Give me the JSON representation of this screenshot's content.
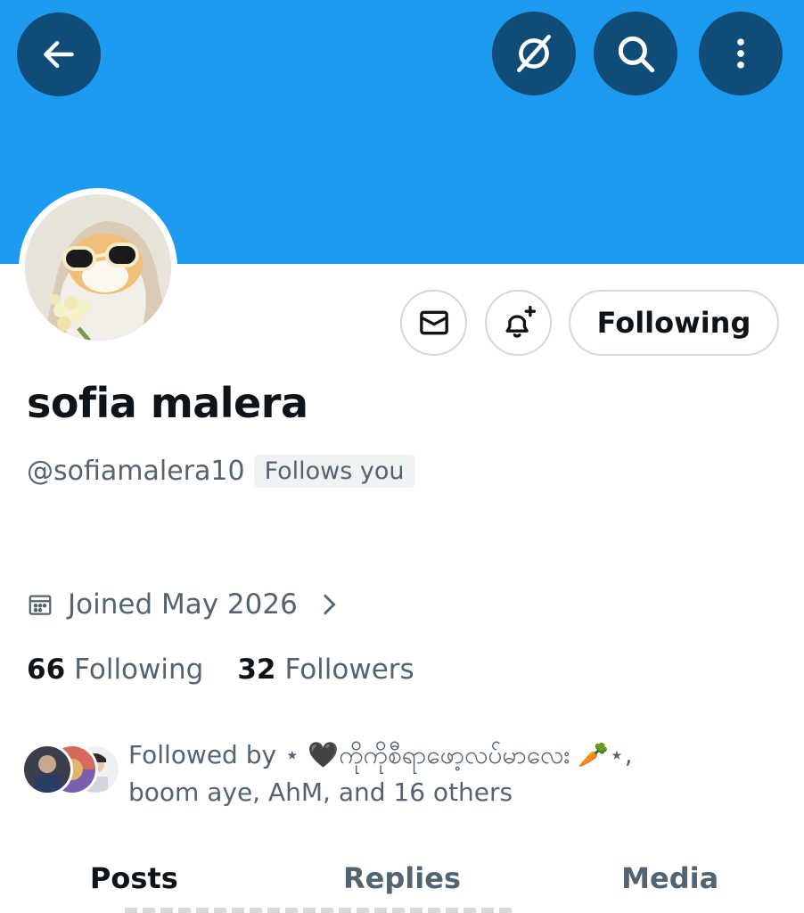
{
  "colors": {
    "banner": "#1d9bf0",
    "header_button_bg": "#0f4c77",
    "secondary_text": "#536471"
  },
  "header": {
    "icons": {
      "back": "arrow-left-icon",
      "grok": "grok-icon",
      "search": "search-icon",
      "more": "more-vertical-icon"
    }
  },
  "actions": {
    "message_icon": "envelope-icon",
    "notify_icon": "bell-plus-icon",
    "following_label": "Following"
  },
  "profile": {
    "display_name": "sofia malera",
    "handle": "@sofiamalera10",
    "follows_you": "Follows you",
    "joined": "Joined May 2026",
    "following_count": "66",
    "following_label": "Following",
    "followers_count": "32",
    "followers_label": "Followers",
    "followed_by_line1": "Followed by ⋆ 🖤ကိုကိုစီရာဖော့လပ်မာလေး 🥕⋆,",
    "followed_by_line2": "boom aye, AhM, and 16 others"
  },
  "tabs": [
    {
      "label": "Posts",
      "active": true
    },
    {
      "label": "Replies",
      "active": false
    },
    {
      "label": "Media",
      "active": false
    }
  ]
}
